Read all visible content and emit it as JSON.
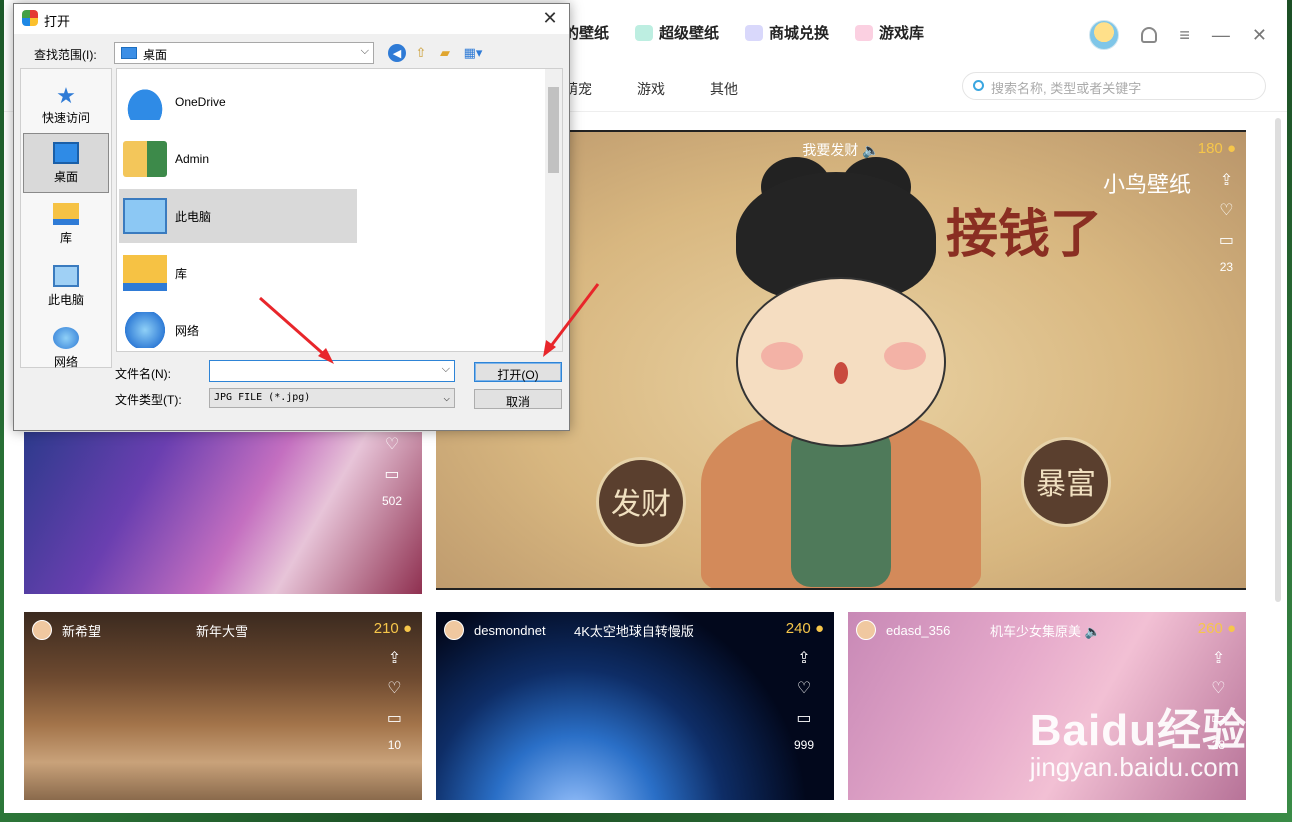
{
  "app": {
    "nav": [
      {
        "label": "的壁纸",
        "color": "#2a7be4"
      },
      {
        "label": "超级壁纸",
        "color": "#3cc4a6"
      },
      {
        "label": "商城兑换",
        "color": "#8f8cf0"
      },
      {
        "label": "游戏库",
        "color": "#f06aa0"
      }
    ],
    "categories": [
      "萌宠",
      "游戏",
      "其他"
    ],
    "search_placeholder": "搜索名称, 类型或者关键字",
    "window_controls": [
      "≡",
      "—",
      "✕"
    ]
  },
  "featured": {
    "title": "我要发财",
    "coins": "180",
    "comments": "23",
    "calligraphy": "接钱了",
    "brand": "小鸟壁纸",
    "seal_left": "发财",
    "seal_right": "暴富"
  },
  "left_card": {
    "comments": "502"
  },
  "cards": [
    {
      "user": "新希望",
      "title": "新年大雪",
      "coins": "210",
      "comments": "10"
    },
    {
      "user": "desmondnet",
      "title": "4K太空地球自转慢版",
      "coins": "240",
      "comments": "999"
    },
    {
      "user": "edasd_356",
      "title": "机车少女集原美",
      "coins": "260",
      "comments": "28"
    }
  ],
  "watermark": {
    "brand": "Baidu经验",
    "url": "jingyan.baidu.com"
  },
  "dialog": {
    "title": "打开",
    "look_in_label": "查找范围(I):",
    "look_in_value": "桌面",
    "places": [
      "快速访问",
      "桌面",
      "库",
      "此电脑",
      "网络"
    ],
    "selected_place": "桌面",
    "files": [
      "OneDrive",
      "Admin",
      "此电脑",
      "库",
      "网络"
    ],
    "selected_file": "此电脑",
    "filename_label": "文件名(N):",
    "filename_value": "",
    "filetype_label": "文件类型(T):",
    "filetype_value": "JPG FILE (*.jpg)",
    "open_button": "打开(O)",
    "cancel_button": "取消"
  },
  "colors": {
    "coin": "#f6c64a",
    "focus_blue": "#2e84d6",
    "arrow_red": "#e8262b",
    "desktop_green": "#2f7d3c"
  }
}
